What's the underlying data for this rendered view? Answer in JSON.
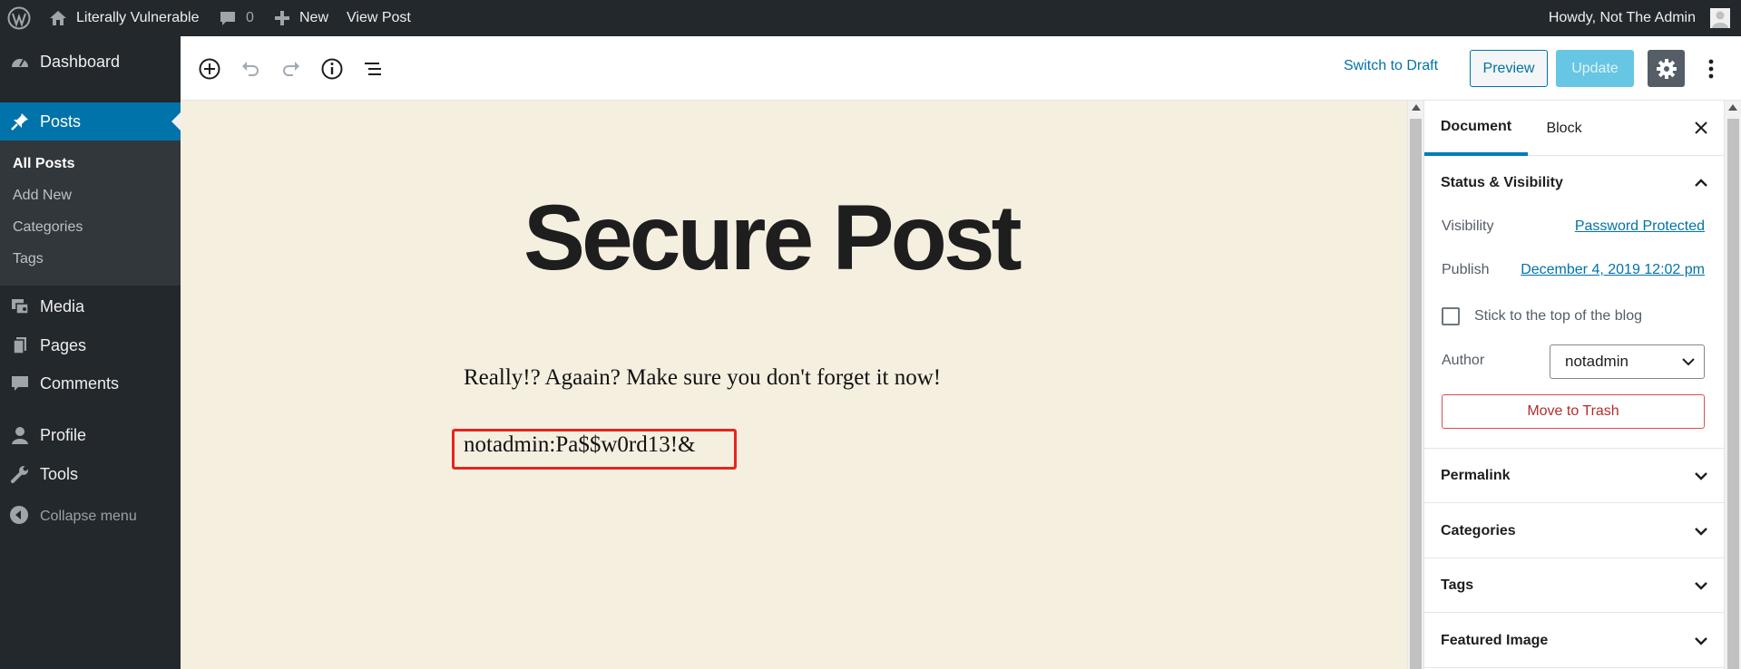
{
  "adminbar": {
    "site_name": "Literally Vulnerable",
    "comments_count": "0",
    "new_label": "New",
    "view_post_label": "View Post",
    "howdy": "Howdy, Not The Admin"
  },
  "menu": {
    "dashboard": "Dashboard",
    "posts": "Posts",
    "submenu": [
      "All Posts",
      "Add New",
      "Categories",
      "Tags"
    ],
    "media": "Media",
    "pages": "Pages",
    "comments": "Comments",
    "profile": "Profile",
    "tools": "Tools",
    "collapse": "Collapse menu"
  },
  "header": {
    "switch_to_draft": "Switch to Draft",
    "preview": "Preview",
    "update": "Update"
  },
  "post": {
    "title": "Secure Post",
    "paragraph1": "Really!? Agaain? Make sure you don't forget it now!",
    "paragraph2": "notadmin:Pa$$w0rd13!&"
  },
  "sidebar": {
    "tabs": [
      "Document",
      "Block"
    ],
    "status_panel": {
      "title": "Status & Visibility",
      "visibility_label": "Visibility",
      "visibility_value": "Password Protected",
      "publish_label": "Publish",
      "publish_value": "December 4, 2019 12:02 pm",
      "sticky_label": "Stick to the top of the blog",
      "sticky_checked": false,
      "author_label": "Author",
      "author_value": "notadmin",
      "trash_label": "Move to Trash"
    },
    "panels": [
      "Permalink",
      "Categories",
      "Tags",
      "Featured Image"
    ]
  },
  "colors": {
    "admin_bar": "#23282d",
    "accent": "#0073aa",
    "content_bg": "#f5efe0",
    "highlight": "#e8241c"
  }
}
